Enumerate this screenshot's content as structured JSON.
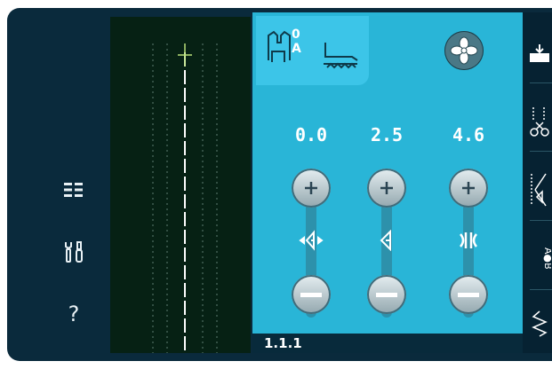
{
  "left_menu": {
    "icons": [
      "stitch-menu-icon",
      "settings-tools-icon",
      "help-icon"
    ],
    "help_label": "?"
  },
  "presser_foot": {
    "foot_code_top": "0",
    "foot_code_bottom": "A",
    "foot_icons": [
      "presser-foot-icon",
      "feed-dogs-icon"
    ]
  },
  "settings": [
    {
      "value": "0.0",
      "control": "stitch-position",
      "icon": "stitch-position-icon"
    },
    {
      "value": "2.5",
      "control": "stitch-length",
      "icon": "stitch-length-icon"
    },
    {
      "value": "4.6",
      "control": "stitch-width",
      "icon": "stitch-width-icon"
    }
  ],
  "status": {
    "label": "1.1.1"
  },
  "sidebar": {
    "icons": [
      "tie-off-icon",
      "thread-cutter-icon",
      "stitch-mirror-icon",
      "sequence-icon",
      "stitch-program-icon"
    ]
  },
  "colors": {
    "background": "#0a2a3c",
    "panel": "#29b5d7",
    "preview": "#062114",
    "accent_stitch": "#b8e07a"
  }
}
